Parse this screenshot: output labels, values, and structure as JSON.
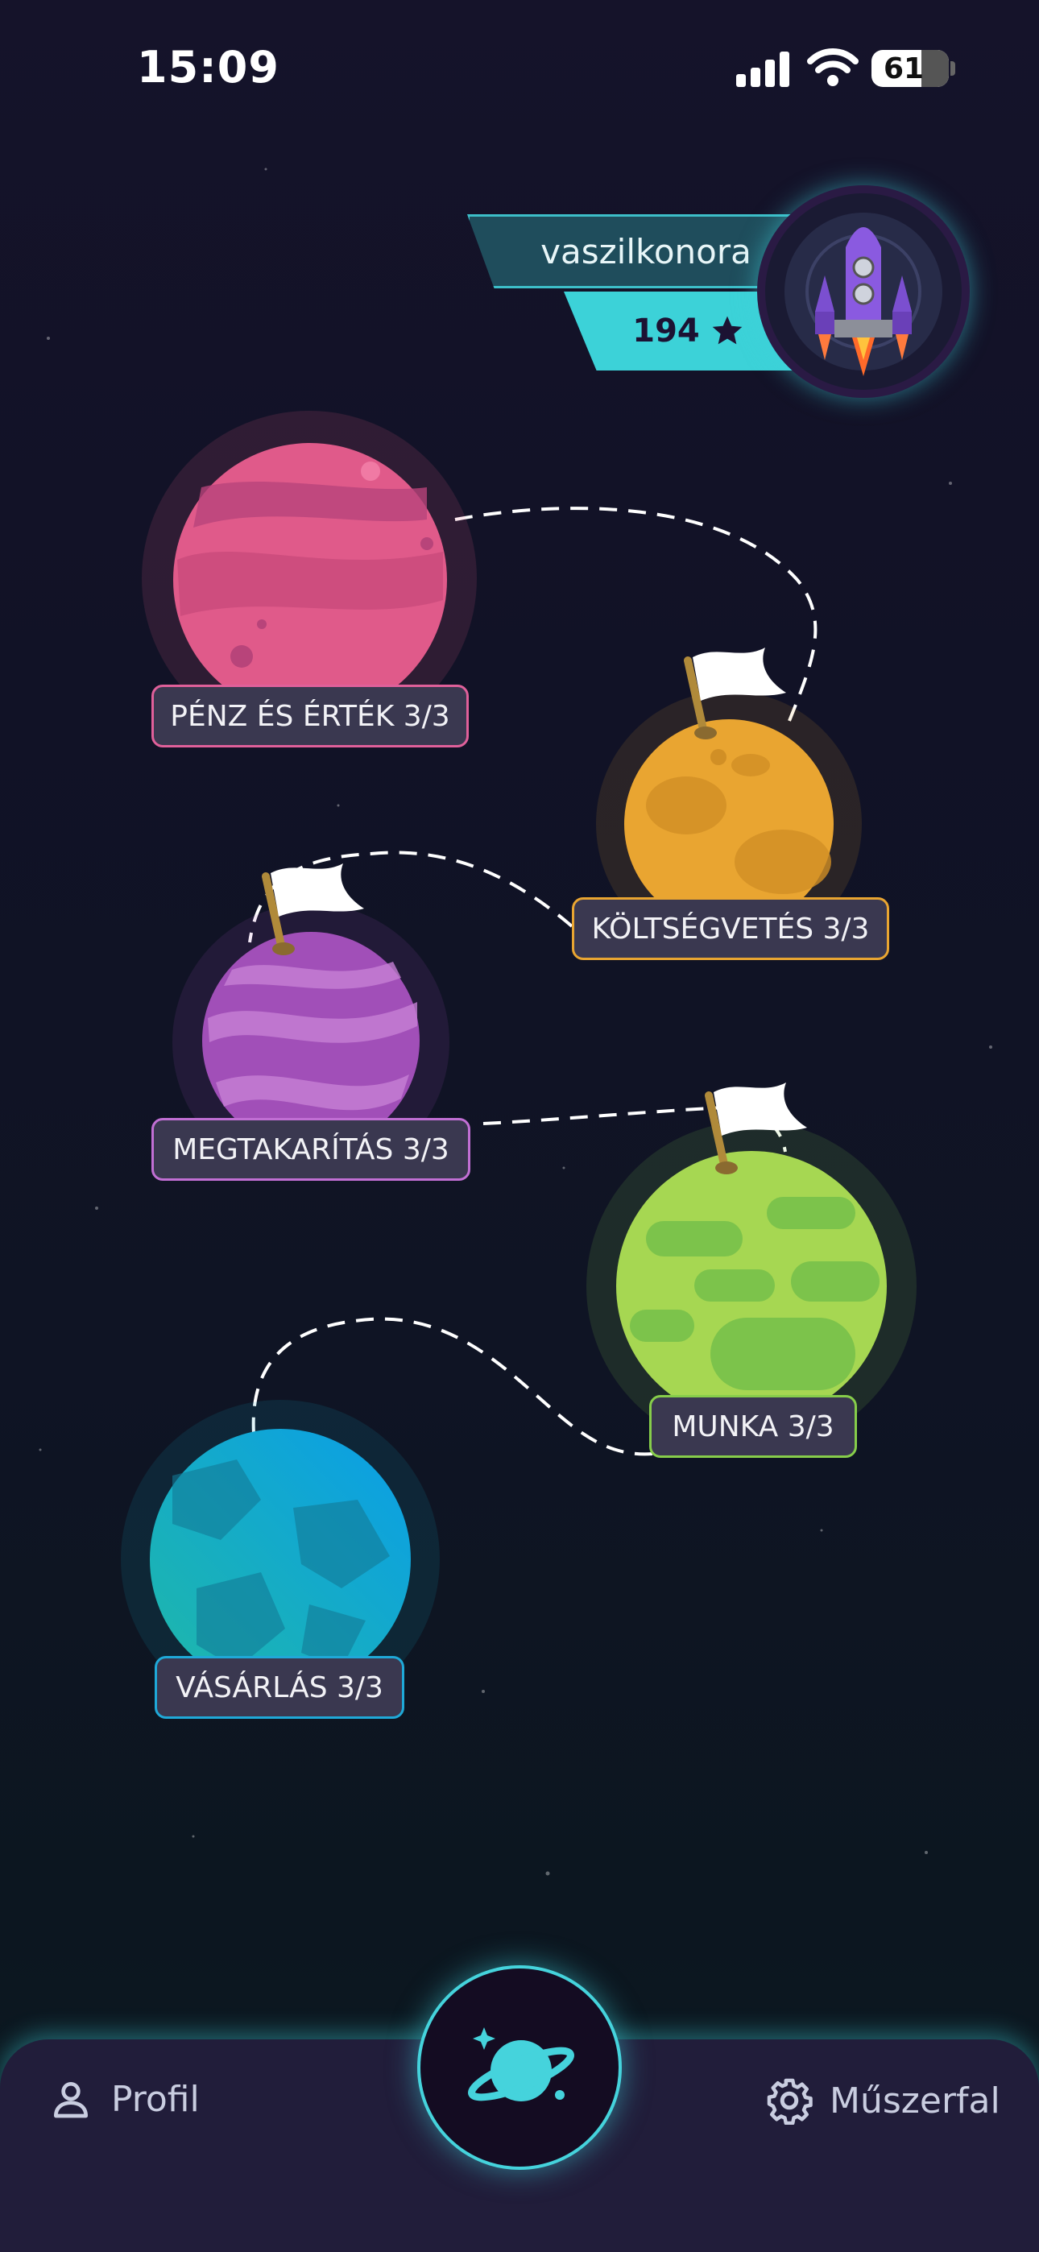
{
  "status_bar": {
    "time": "15:09",
    "battery": "61"
  },
  "user": {
    "username": "vaszilkonora",
    "points": "194",
    "avatar_icon": "rocket-icon"
  },
  "planets": [
    {
      "label": "PÉNZ ÉS ÉRTÉK 3/3",
      "color": "#e05a8a",
      "flag": false
    },
    {
      "label": "KÖLTSÉGVETÉS 3/3",
      "color": "#e9a531",
      "flag": true
    },
    {
      "label": "MEGTAKARÍTÁS 3/3",
      "color": "#a14fb8",
      "flag": true
    },
    {
      "label": "MUNKA 3/3",
      "color": "#86cd4a",
      "flag": true
    },
    {
      "label": "VÁSÁRLÁS 3/3",
      "color": "#10a9cf",
      "flag": false
    }
  ],
  "nav": {
    "profile_label": "Profil",
    "dashboard_label": "Műszerfal",
    "center_icon": "planet-icon"
  },
  "colors": {
    "accent": "#3cd2d8",
    "nav_bg": "#211d3a"
  }
}
